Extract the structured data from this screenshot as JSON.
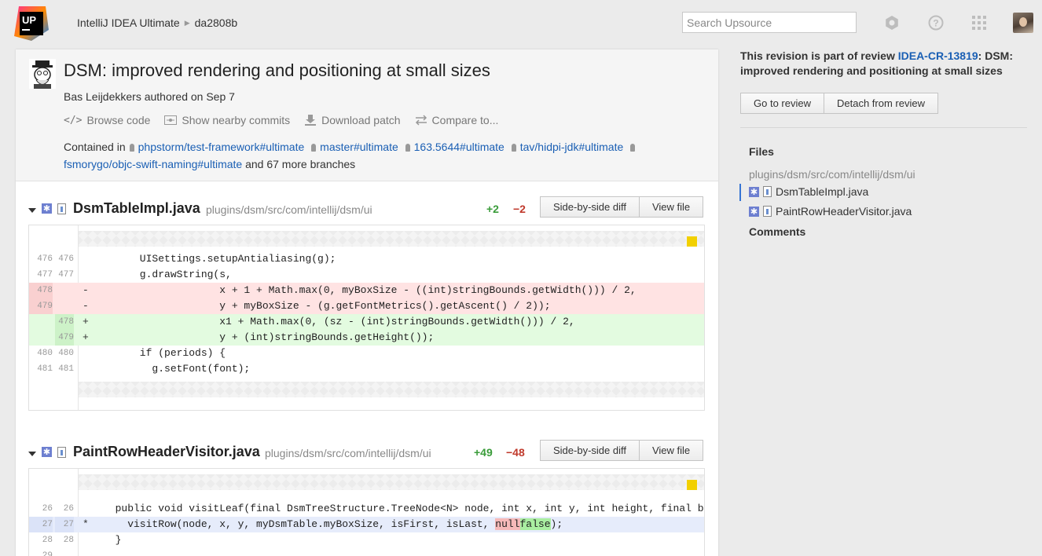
{
  "header": {
    "logo_text": "UP",
    "breadcrumb": [
      "IntelliJ IDEA Ultimate",
      "da2808b"
    ],
    "search_placeholder": "Search Upsource"
  },
  "revision": {
    "title": "DSM: improved rendering and positioning at small sizes",
    "author_line": "Bas Leijdekkers authored on Sep 7",
    "actions": [
      "Browse code",
      "Show nearby commits",
      "Download patch",
      "Compare to..."
    ],
    "contained_prefix": "Contained in",
    "branches": [
      "phpstorm/test-framework#ultimate",
      "master#ultimate",
      "163.5644#ultimate",
      "tav/hidpi-jdk#ultimate",
      "fsmorygo/objc-swift-naming#ultimate"
    ],
    "contained_suffix": "and 67 more branches"
  },
  "files": [
    {
      "name": "DsmTableImpl.java",
      "path": "plugins/dsm/src/com/intellij/dsm/ui",
      "added": "+2",
      "removed": "−2",
      "btn_side": "Side-by-side diff",
      "btn_view": "View file",
      "lines": [
        {
          "type": "ctx",
          "l1": "476",
          "l2": "476",
          "mk": "",
          "code": "      UISettings.setupAntialiasing(g);"
        },
        {
          "type": "ctx",
          "l1": "477",
          "l2": "477",
          "mk": "",
          "code": "      g.drawString(s,"
        },
        {
          "type": "del",
          "l1": "478",
          "l2": "",
          "mk": "-",
          "code": "                   x + 1 + Math.max(0, myBoxSize - ((int)stringBounds.getWidth())) / 2,"
        },
        {
          "type": "del",
          "l1": "479",
          "l2": "",
          "mk": "-",
          "code": "                   y + myBoxSize - (g.getFontMetrics().getAscent() / 2));"
        },
        {
          "type": "add",
          "l1": "",
          "l2": "478",
          "mk": "+",
          "code": "                   x1 + Math.max(0, (sz - (int)stringBounds.getWidth())) / 2,"
        },
        {
          "type": "add",
          "l1": "",
          "l2": "479",
          "mk": "+",
          "code": "                   y + (int)stringBounds.getHeight());"
        },
        {
          "type": "ctx",
          "l1": "480",
          "l2": "480",
          "mk": "",
          "code": "      if (periods) {"
        },
        {
          "type": "ctx",
          "l1": "481",
          "l2": "481",
          "mk": "",
          "code": "        g.setFont(font);"
        }
      ]
    },
    {
      "name": "PaintRowHeaderVisitor.java",
      "path": "plugins/dsm/src/com/intellij/dsm/ui",
      "added": "+49",
      "removed": "−48",
      "btn_side": "Side-by-side diff",
      "btn_view": "View file",
      "lines": [
        {
          "type": "ctx",
          "l1": "26",
          "l2": "26",
          "mk": "",
          "code": "  public void visitLeaf(final DsmTreeStructure.TreeNode<N> node, int x, int y, int height, final boolean isFirst"
        },
        {
          "type": "mod",
          "l1": "27",
          "l2": "27",
          "mk": "*",
          "code_pre": "    visitRow(node, x, y, myDsmTable.myBoxSize, isFirst, isLast, ",
          "code_del": "null",
          "code_add": "false",
          "code_post": ");"
        },
        {
          "type": "ctx",
          "l1": "28",
          "l2": "28",
          "mk": "",
          "code": "  }"
        },
        {
          "type": "ctx",
          "l1": "29",
          "l2": "",
          "mk": "",
          "code": ""
        }
      ]
    }
  ],
  "sidebar": {
    "review_prefix": "This revision is part of review",
    "review_id": "IDEA-CR-13819",
    "review_suffix": ": DSM: improved rendering and positioning at small sizes",
    "btn_goto": "Go to review",
    "btn_detach": "Detach from review",
    "files_title": "Files",
    "files_path": "plugins/dsm/src/com/intellij/dsm/ui",
    "files": [
      "DsmTableImpl.java",
      "PaintRowHeaderVisitor.java"
    ],
    "comments_title": "Comments"
  },
  "colors": {
    "link": "#1a5fb4",
    "added": "#3a9c3a",
    "removed": "#c0392b",
    "logo_bg": "#1b1b1b"
  }
}
